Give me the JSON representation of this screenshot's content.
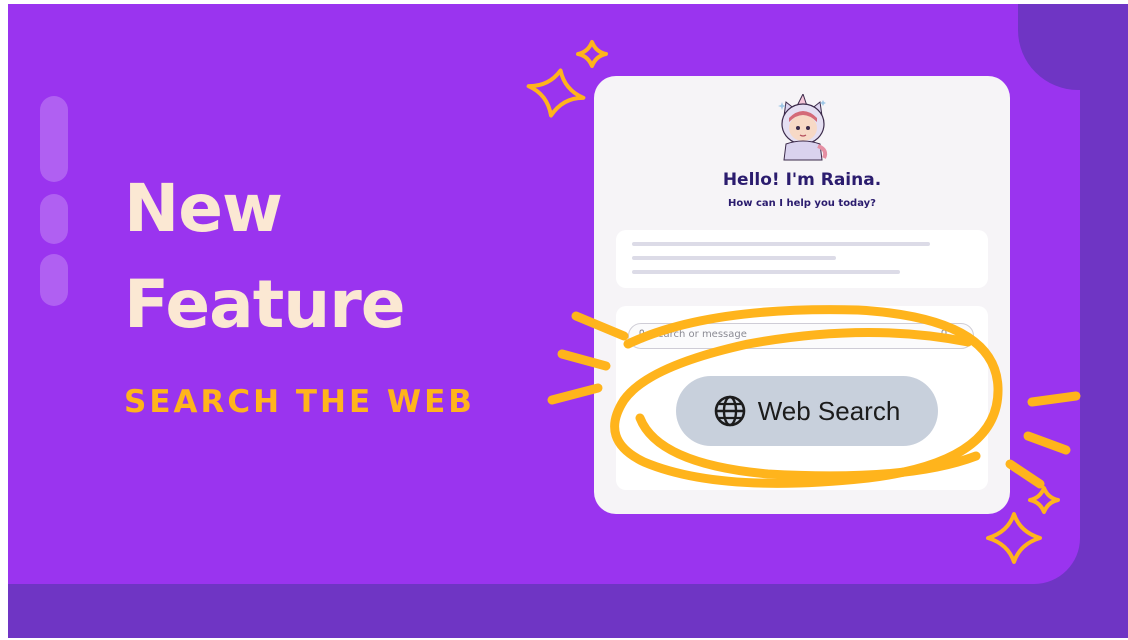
{
  "hero": {
    "title_line1": "New",
    "title_line2": "Feature",
    "subtitle": "SEARCH THE WEB"
  },
  "chat_panel": {
    "avatar_icon": "unicorn-girl-avatar-icon",
    "greeting": "Hello! I'm Raina.",
    "prompt": "How can I help you today?",
    "search_placeholder": "Search or message",
    "web_search_label": "Web Search",
    "web_search_icon": "globe-icon"
  },
  "colors": {
    "card_bg": "#9a34ef",
    "frame_bg": "#6f35c4",
    "title_text": "#fbe8d3",
    "accent": "#ffb41c",
    "panel_bg": "#f6f4f7",
    "heading_text": "#2b1c6e",
    "button_bg": "#c8d0dc"
  }
}
